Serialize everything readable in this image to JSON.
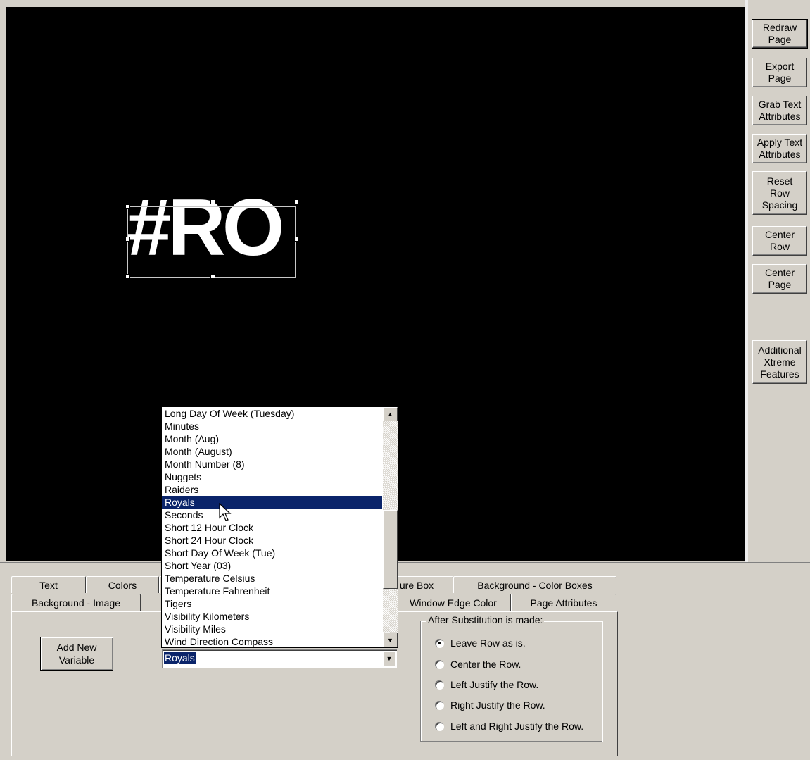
{
  "canvas": {
    "text_object": "#RO"
  },
  "sidebar": {
    "buttons": [
      "Redraw\nPage",
      "Export\nPage",
      "Grab Text\nAttributes",
      "Apply Text\nAttributes",
      "Reset\nRow\nSpacing",
      "Center\nRow",
      "Center\nPage",
      "Additional\nXtreme\nFeatures"
    ]
  },
  "tabs": {
    "row1": [
      "Text",
      "Colors",
      "",
      "ure Box",
      "Background - Color Boxes"
    ],
    "row2": [
      "Background - Image",
      "",
      "Window Edge Color",
      "Page Attributes"
    ]
  },
  "panel": {
    "add_variable_label": "Add New\nVariable",
    "combo_value": "Royals",
    "list_items": [
      "Long Day Of Week (Tuesday)",
      "Minutes",
      "Month (Aug)",
      "Month (August)",
      "Month Number (8)",
      "Nuggets",
      "Raiders",
      "Royals",
      "Seconds",
      "Short 12 Hour Clock",
      "Short 24 Hour Clock",
      "Short Day Of Week (Tue)",
      "Short Year (03)",
      "Temperature Celsius",
      "Temperature Fahrenheit",
      "Tigers",
      "Visibility Kilometers",
      "Visibility Miles",
      "Wind Direction Compass"
    ],
    "selected_item": "Royals",
    "group_title": "After Substitution is made:",
    "radio_options": [
      "Leave Row as is.",
      "Center the Row.",
      "Left Justify the Row.",
      "Right Justify the Row.",
      "Left and Right Justify the Row."
    ],
    "radio_selected": "Leave Row as is."
  }
}
